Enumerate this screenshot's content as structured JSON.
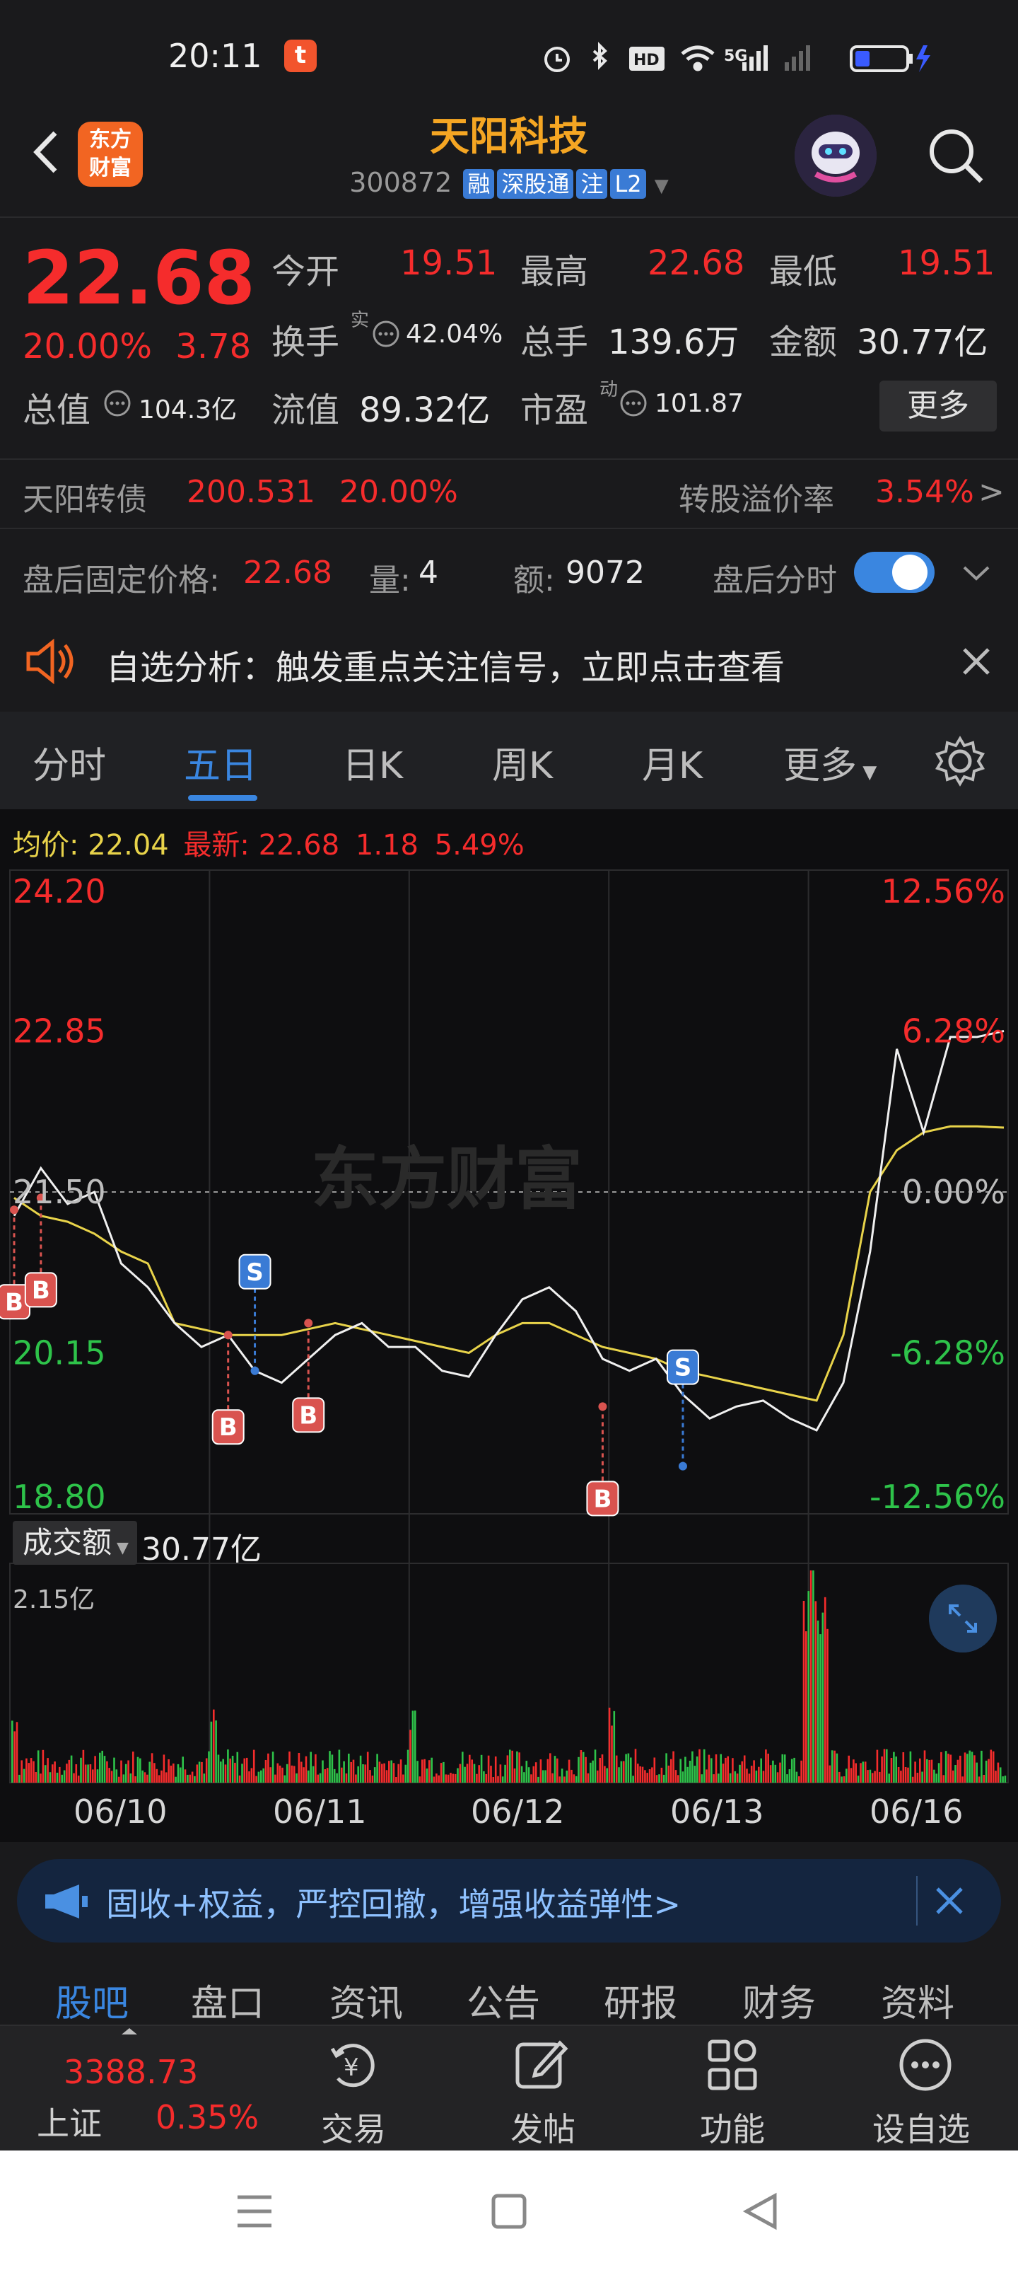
{
  "status_bar": {
    "time": "20:11",
    "app_badge": "t"
  },
  "header": {
    "logo_line1": "东方",
    "logo_line2": "财富",
    "stock_name": "天阳科技",
    "code": "300872",
    "tags": [
      "融",
      "深股通",
      "注",
      "L2"
    ]
  },
  "quote": {
    "price": "22.68",
    "change_pct": "20.00%",
    "change": "3.78",
    "open_label": "今开",
    "open": "19.51",
    "high_label": "最高",
    "high": "22.68",
    "low_label": "最低",
    "low": "19.51",
    "turnover_label": "换手",
    "turnover_sup": "实",
    "turnover": "42.04%",
    "volume_label": "总手",
    "volume": "139.6万",
    "amount_label": "金额",
    "amount": "30.77亿",
    "mktcap_label": "总值",
    "mktcap": "104.3亿",
    "float_label": "流值",
    "float_cap": "89.32亿",
    "pe_label": "市盈",
    "pe_sup": "动",
    "pe": "101.87",
    "more_button": "更多"
  },
  "bond": {
    "name": "天阳转债",
    "price": "200.531",
    "pct": "20.00%",
    "premium_label": "转股溢价率",
    "premium": "3.54%",
    "arrow": ">"
  },
  "after_hours": {
    "price_label": "盘后固定价格:",
    "price": "22.68",
    "vol_label": "量:",
    "vol": "4",
    "amt_label": "额:",
    "amt": "9072",
    "toggle_label": "盘后分时"
  },
  "notice": {
    "text": "自选分析：触发重点关注信号，立即点击查看"
  },
  "chart_tabs": [
    "分时",
    "五日",
    "日K",
    "周K",
    "月K",
    "更多"
  ],
  "chart_info": {
    "avg_label": "均价:",
    "avg": "22.04",
    "latest_label": "最新:",
    "latest": "22.68",
    "latest_change": "1.18",
    "latest_pct": "5.49%",
    "watermark": "东方财富"
  },
  "chart_data": {
    "type": "line",
    "title": "",
    "x_days": [
      "06/10",
      "06/11",
      "06/12",
      "06/13",
      "06/16"
    ],
    "y_ticks": [
      "24.20",
      "22.85",
      "21.50",
      "20.15",
      "18.80"
    ],
    "pct_ticks": [
      "12.56%",
      "6.28%",
      "0.00%",
      "-6.28%",
      "-12.56%"
    ],
    "ylim": [
      18.8,
      24.2
    ],
    "reference": 21.5,
    "series": [
      {
        "name": "price",
        "values": [
          21.3,
          21.7,
          21.4,
          21.5,
          20.9,
          20.7,
          20.4,
          20.2,
          20.3,
          20.0,
          19.9,
          20.1,
          20.3,
          20.4,
          20.2,
          20.2,
          20.0,
          19.95,
          20.3,
          20.6,
          20.7,
          20.5,
          20.1,
          20.0,
          20.1,
          19.8,
          19.6,
          19.7,
          19.75,
          19.6,
          19.5,
          19.9,
          21.0,
          22.7,
          22.0,
          22.8,
          22.8,
          22.85
        ]
      },
      {
        "name": "average",
        "values": [
          21.45,
          21.3,
          21.25,
          21.15,
          21.0,
          20.9,
          20.4,
          20.35,
          20.3,
          20.3,
          20.3,
          20.35,
          20.4,
          20.35,
          20.3,
          20.25,
          20.2,
          20.15,
          20.3,
          20.4,
          20.4,
          20.3,
          20.2,
          20.15,
          20.1,
          20.0,
          19.95,
          19.9,
          19.85,
          19.8,
          19.75,
          20.3,
          21.5,
          21.85,
          22.0,
          22.05,
          22.05,
          22.04
        ]
      }
    ],
    "markers": [
      {
        "label": "B",
        "value": 21.35
      },
      {
        "label": "B",
        "value": 21.45
      },
      {
        "label": "B",
        "value": 20.3
      },
      {
        "label": "S",
        "value": 20.0
      },
      {
        "label": "B",
        "value": 20.4
      },
      {
        "label": "B",
        "value": 19.7
      },
      {
        "label": "S",
        "value": 19.2
      }
    ],
    "volume": {
      "label": "成交额",
      "total": "30.77亿",
      "max": "2.15亿"
    }
  },
  "ad": {
    "text": "固收+权益，严控回撤，增强收益弹性>"
  },
  "section_tabs": [
    "股吧",
    "盘口",
    "资讯",
    "公告",
    "研报",
    "财务",
    "资料"
  ],
  "bottom_nav": {
    "index_value": "3388.73",
    "index_name": "上证",
    "index_pct": "0.35%",
    "items": [
      "交易",
      "发帖",
      "功能",
      "设自选"
    ]
  },
  "colors": {
    "up": "#f52c2c",
    "down": "#2ec34a",
    "accent": "#3a86e0",
    "brand": "#f26522",
    "avg_line": "#e8d34a"
  }
}
